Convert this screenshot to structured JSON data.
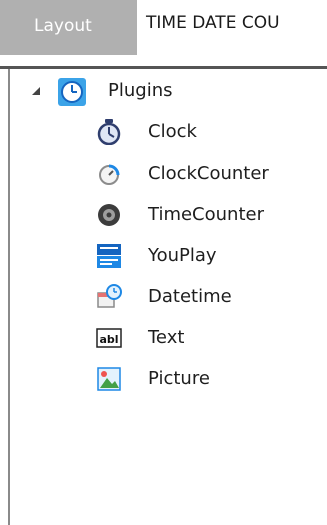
{
  "tabs": {
    "active": "Layout",
    "inactive": "TIME DATE COU"
  },
  "tree": {
    "root": {
      "label": "Plugins",
      "expanded": true,
      "icon": "clock-badge-icon"
    },
    "children": [
      {
        "label": "Clock",
        "icon": "stopwatch-icon"
      },
      {
        "label": "ClockCounter",
        "icon": "clock-counter-icon"
      },
      {
        "label": "TimeCounter",
        "icon": "time-counter-icon"
      },
      {
        "label": "YouPlay",
        "icon": "youplay-icon"
      },
      {
        "label": "Datetime",
        "icon": "datetime-icon"
      },
      {
        "label": "Text",
        "icon": "text-abl-icon"
      },
      {
        "label": "Picture",
        "icon": "picture-icon"
      }
    ]
  }
}
